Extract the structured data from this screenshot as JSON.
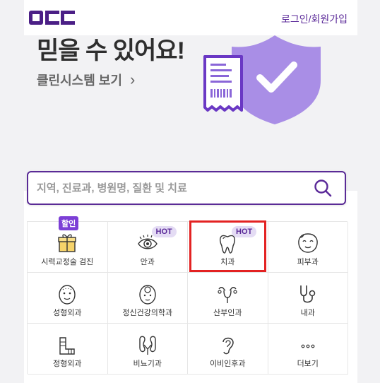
{
  "header": {
    "logo_text": "OCC",
    "login_label": "로그인/회원가입"
  },
  "hero": {
    "title": "믿을 수 있어요!",
    "link_label": "클린시스템 보기",
    "link_arrow": "›",
    "slide_count": 5,
    "active_slide": 3
  },
  "search": {
    "placeholder": "지역, 진료과, 병원명, 질환 및 치료"
  },
  "categories": [
    {
      "label": "시력교정술 검진",
      "icon": "gift-icon",
      "badge": "할인"
    },
    {
      "label": "안과",
      "icon": "eye-icon",
      "badge": "HOT"
    },
    {
      "label": "치과",
      "icon": "tooth-icon",
      "badge": "HOT"
    },
    {
      "label": "피부과",
      "icon": "face-icon",
      "badge": ""
    },
    {
      "label": "성형외과",
      "icon": "face-bald-icon",
      "badge": ""
    },
    {
      "label": "정신건강의학과",
      "icon": "head-icon",
      "badge": ""
    },
    {
      "label": "산부인과",
      "icon": "uterus-icon",
      "badge": ""
    },
    {
      "label": "내과",
      "icon": "stethoscope-icon",
      "badge": ""
    },
    {
      "label": "정형외과",
      "icon": "cast-icon",
      "badge": ""
    },
    {
      "label": "비뇨기과",
      "icon": "kidney-icon",
      "badge": ""
    },
    {
      "label": "이비인후과",
      "icon": "ear-icon",
      "badge": ""
    },
    {
      "label": "더보기",
      "icon": "more-icon",
      "badge": ""
    }
  ],
  "colors": {
    "brand": "#5b2a99",
    "highlight": "#e32222",
    "hero_bg": "#f2f2f4"
  }
}
